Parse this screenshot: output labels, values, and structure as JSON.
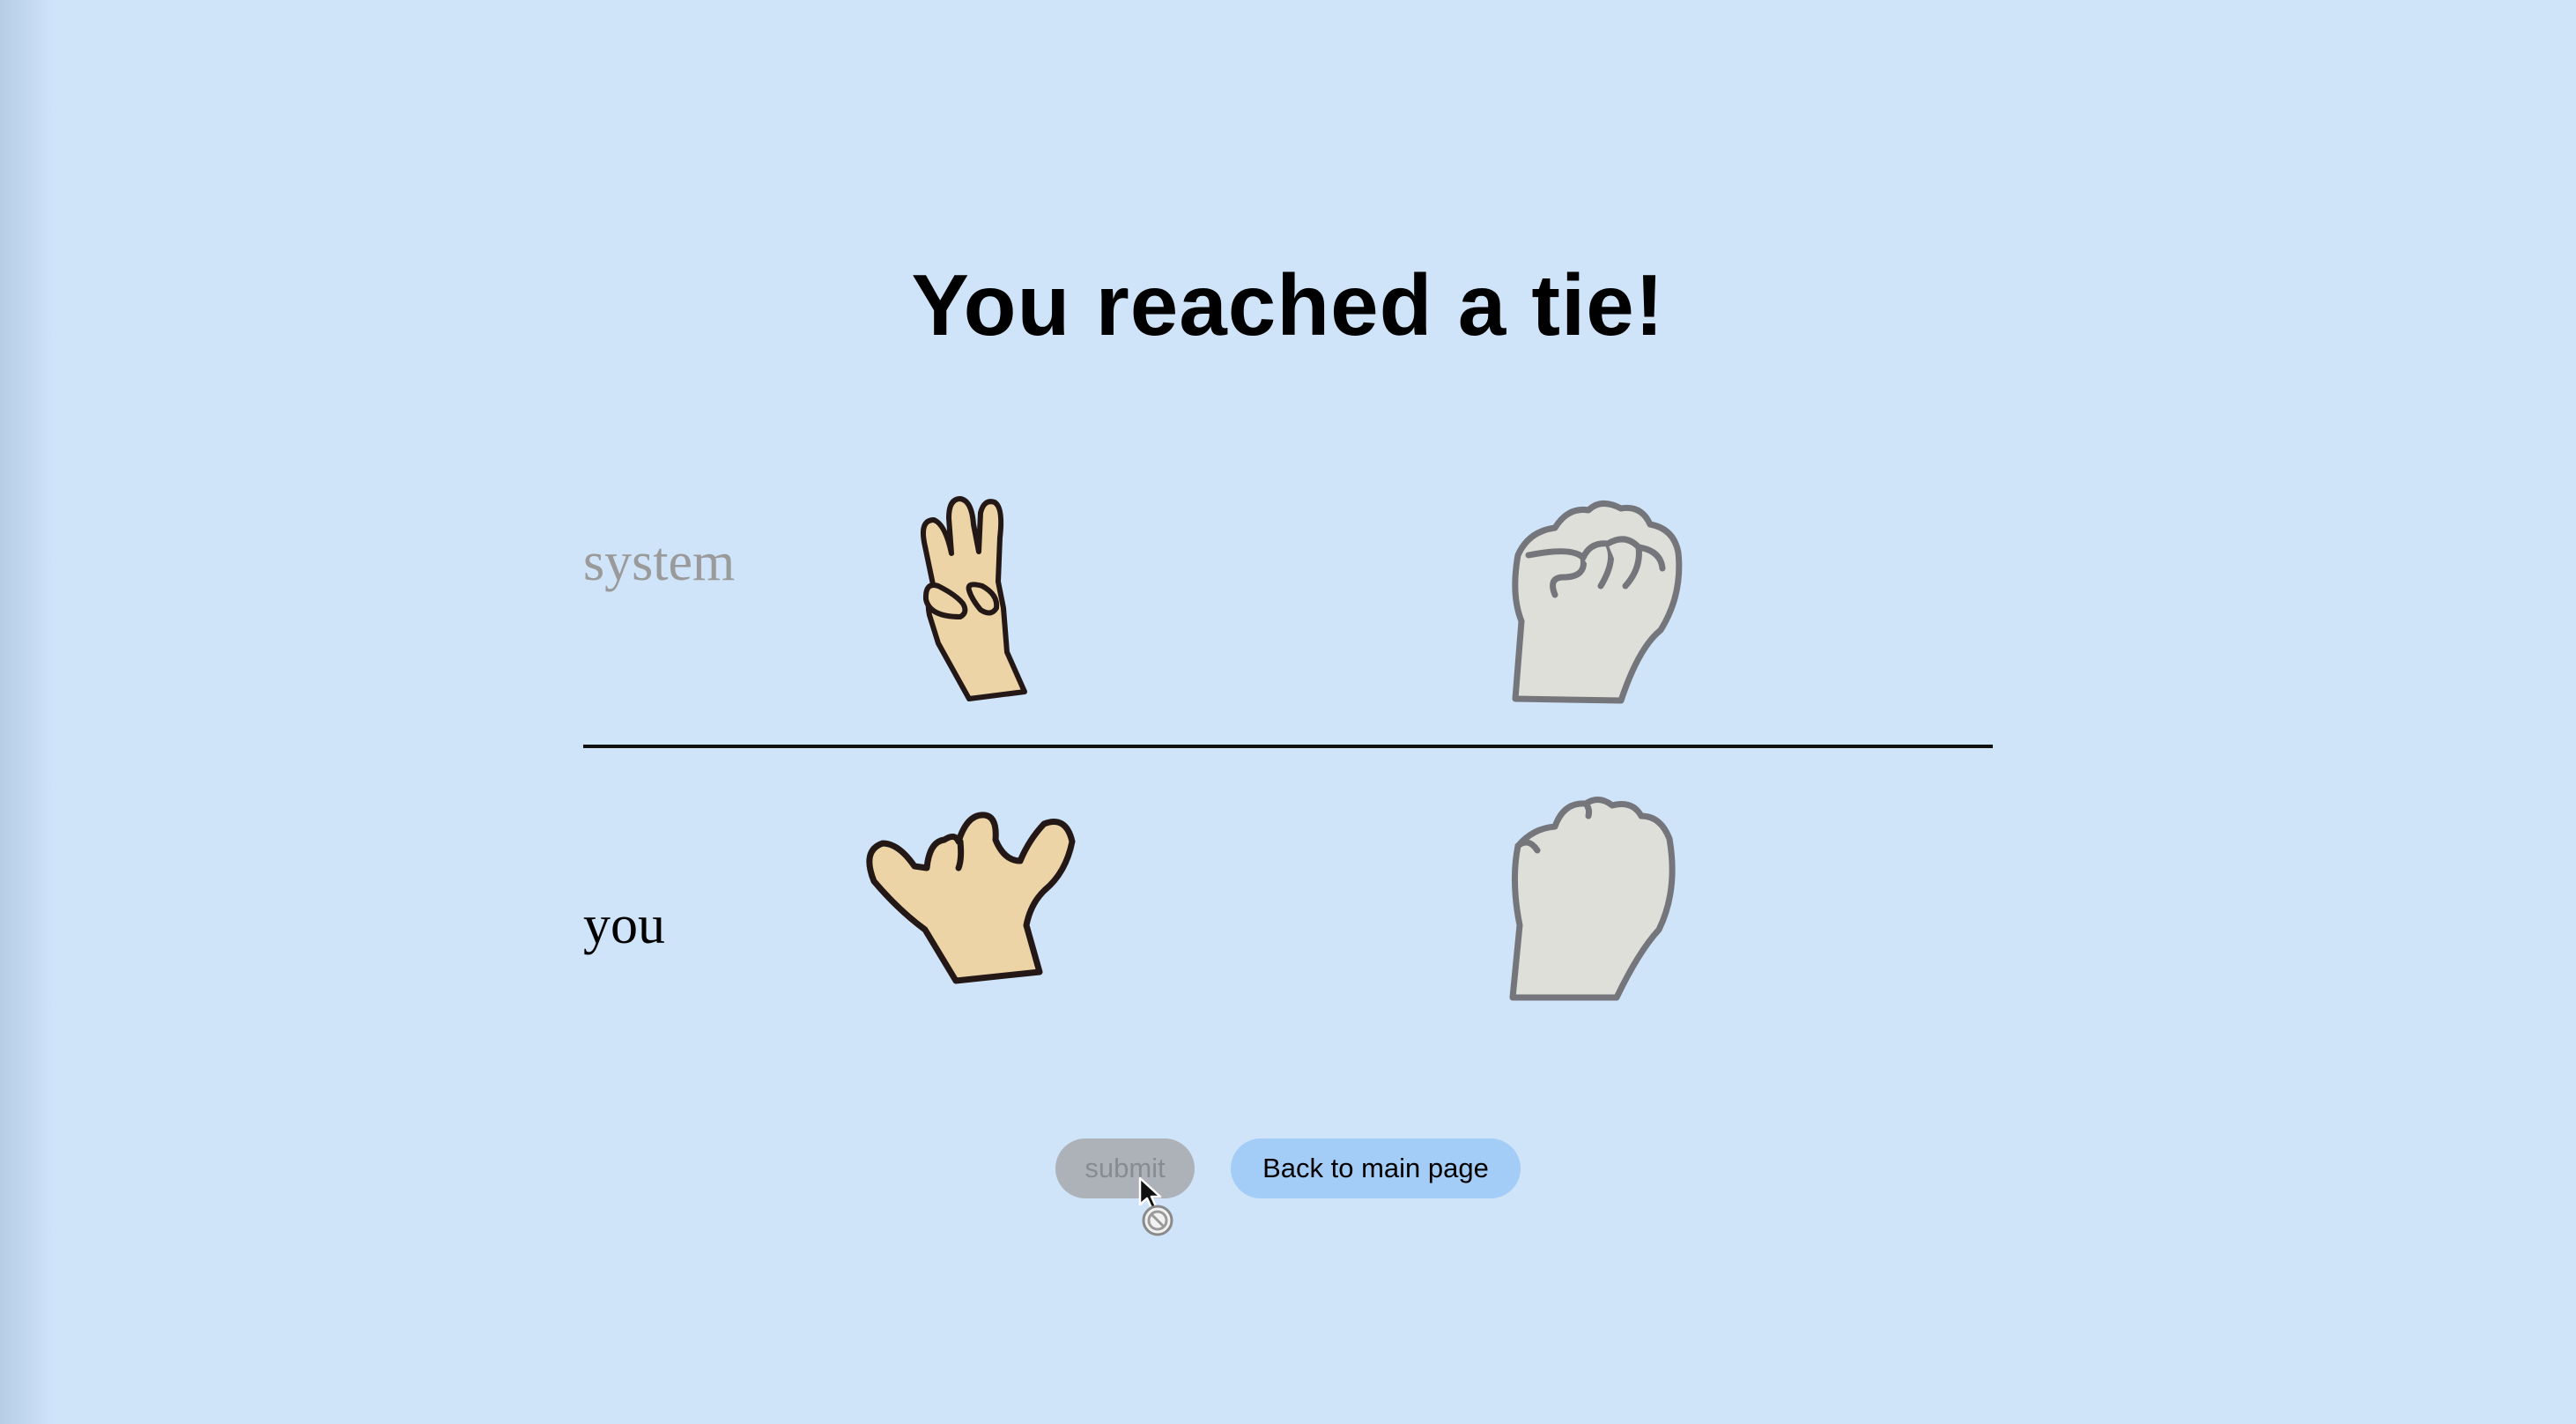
{
  "title": "You reached a tie!",
  "rows": {
    "system_label": "system",
    "you_label": "you"
  },
  "hands": {
    "system_selected": "three-finger-hand-icon",
    "system_option": "fist-icon",
    "you_selected": "pinky-thumb-hand-icon",
    "you_option": "fist-icon"
  },
  "buttons": {
    "submit_label": "submit",
    "back_label": "Back to main page"
  },
  "colors": {
    "background": "#cfe3f9",
    "skin": "#ecd4a6",
    "inactive_hand": "#dedfd8",
    "submit_disabled": "#acb2b8",
    "back_button": "#a3ccf7"
  }
}
